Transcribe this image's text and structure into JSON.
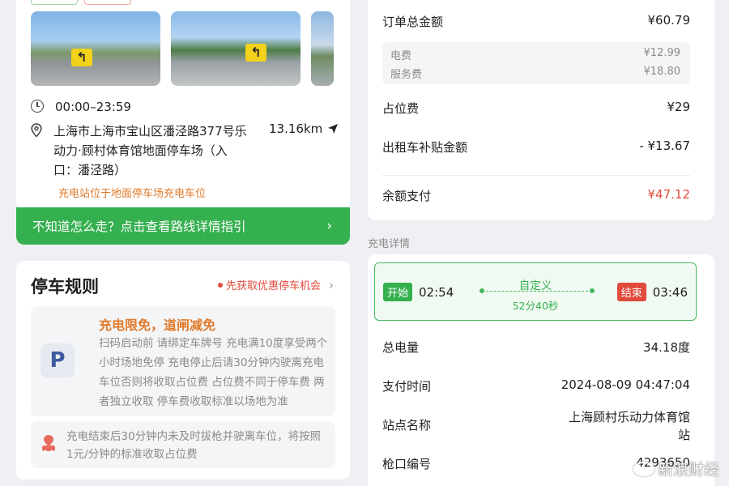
{
  "station": {
    "hours": "00:00–23:59",
    "address": "上海市上海市宝山区潘泾路377号乐动力·顾村体育馆地面停车场（入口：潘泾路）",
    "distance": "13.16km",
    "location_note": "充电站位于地面停车场充电车位",
    "icons": {
      "clock": "clock-icon",
      "pin": "location-pin-icon",
      "navigate": "navigate-arrow-icon"
    }
  },
  "guide": {
    "label": "不知道怎么走？点击查看路线详情指引"
  },
  "parking_rules": {
    "title": "停车规则",
    "promo": "先获取优惠停车机会",
    "rule_head": "充电限免，道闸减免",
    "rule_body": "扫码启动前 请绑定车牌号 充电满10度享受两个小时场地免停 充电停止后请30分钟内驶离充电车位否则将收取占位费 占位费不同于停车费 两者独立收取 停车费收取标准以场地为准",
    "warning": "充电结束后30分钟内未及时拔枪并驶离车位，将按照1元/分钟的标准收取占位费"
  },
  "order": {
    "total_label": "订单总金额",
    "total_value": "¥60.79",
    "elec_label": "电费",
    "elec_value": "¥12.99",
    "service_label": "服务费",
    "service_value": "¥18.80",
    "occupy_label": "占位费",
    "occupy_value": "¥29",
    "taxi_label": "出租车补贴金额",
    "taxi_value": "- ¥13.67",
    "balance_label": "余额支付",
    "balance_value": "¥47.12"
  },
  "detail": {
    "section_title": "充电详情",
    "start_label": "开始",
    "start_time": "02:54",
    "mode": "自定义",
    "duration": "52分40秒",
    "end_label": "结束",
    "end_time": "03:46",
    "energy_label": "总电量",
    "energy_value": "34.18度",
    "paytime_label": "支付时间",
    "paytime_value": "2024-08-09 04:47:04",
    "station_label": "站点名称",
    "station_value": "上海顾村乐动力体育馆站",
    "gun_label": "枪口编号",
    "gun_value": "4293650"
  },
  "watermark": "新浪财经",
  "colors": {
    "green": "#35b04f",
    "red": "#e14b3c",
    "orange": "#e07a2a"
  }
}
